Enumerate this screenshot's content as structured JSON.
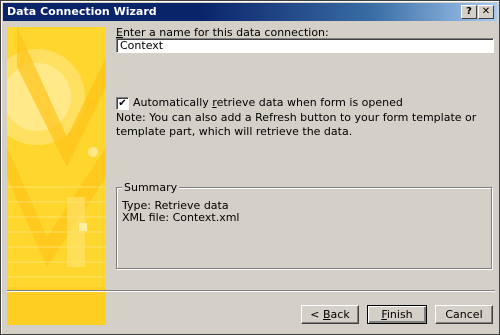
{
  "window": {
    "title": "Data Connection Wizard",
    "help_glyph": "?",
    "close_glyph": "✕"
  },
  "name_field": {
    "label_pre": "",
    "label_key": "E",
    "label_post": "nter a name for this data connection:",
    "value": "Context"
  },
  "auto_retrieve": {
    "checked": true,
    "check_glyph": "✔",
    "label_pre": "Automatically ",
    "label_key": "r",
    "label_post": "etrieve data when form is opened"
  },
  "note": "Note: You can also add a Refresh button to your form template or template part, which will retrieve the data.",
  "summary": {
    "legend": "Summary",
    "type_line": "Type: Retrieve data",
    "xml_line": "XML file: Context.xml"
  },
  "buttons": {
    "back": {
      "pre": "< ",
      "key": "B",
      "post": "ack"
    },
    "finish": {
      "pre": "",
      "key": "F",
      "post": "inish"
    },
    "cancel": {
      "label": "Cancel"
    }
  },
  "colors": {
    "titlebar_start": "#0a246a",
    "titlebar_end": "#a6caf0",
    "dialog_bg": "#d4d0c8",
    "art_yellow": "#ffd12a"
  }
}
